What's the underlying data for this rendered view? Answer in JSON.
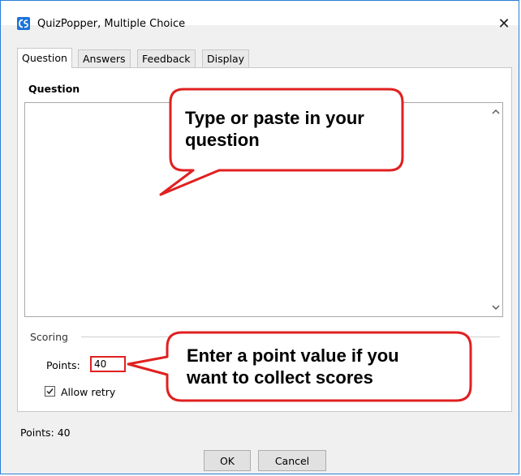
{
  "window": {
    "title": "QuizPopper, Multiple Choice",
    "icon": "quizpopper-app-icon",
    "close_glyph": "✕"
  },
  "tabs": [
    {
      "label": "Question",
      "active": true
    },
    {
      "label": "Answers",
      "active": false
    },
    {
      "label": "Feedback",
      "active": false
    },
    {
      "label": "Display",
      "active": false
    }
  ],
  "question": {
    "heading": "Question",
    "value": ""
  },
  "scoring": {
    "legend": "Scoring",
    "points_label": "Points:",
    "points_value": "40",
    "allow_retry_label": "Allow retry",
    "allow_retry_checked": true
  },
  "status": {
    "text": "Points: 40"
  },
  "buttons": {
    "ok": "OK",
    "cancel": "Cancel"
  },
  "callouts": {
    "question": {
      "line1": "Type or paste in your",
      "line2": "question"
    },
    "points": {
      "line1": "Enter a point value if you",
      "line2": "want to collect scores"
    },
    "border_color": "#e02020"
  }
}
